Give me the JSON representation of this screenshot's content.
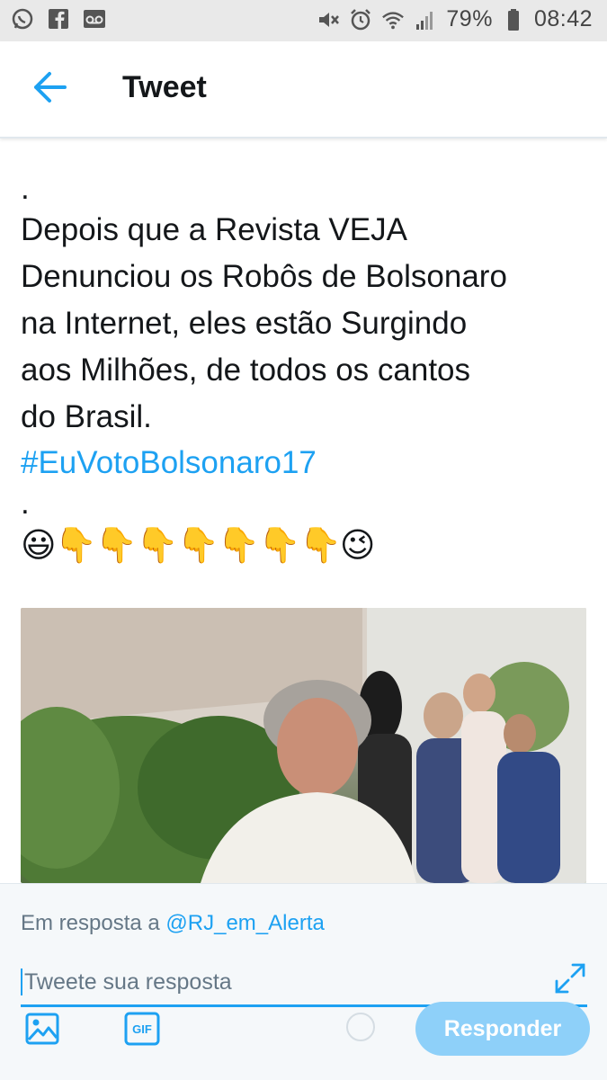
{
  "status_bar": {
    "battery": "79%",
    "time": "08:42",
    "icons_left": [
      "whatsapp-icon",
      "facebook-icon",
      "voicemail-icon"
    ],
    "icons_right": [
      "mute-icon",
      "alarm-icon",
      "wifi-icon",
      "signal-icon",
      "battery-icon"
    ]
  },
  "header": {
    "title": "Tweet",
    "back_icon": "arrow-left-icon"
  },
  "tweet": {
    "dot_top": ".",
    "lines": [
      "Depois que a Revista VEJA",
      "Denunciou os Robôs de Bolsonaro",
      "na Internet, eles estão Surgindo",
      "aos Milhões, de todos os cantos",
      "do Brasil."
    ],
    "hashtag": "#EuVotoBolsonaro17",
    "dot_bottom": ".",
    "emojis": "😃👇👇👇👇👇👇👇😉"
  },
  "media": {
    "type": "video-thumbnail"
  },
  "reply": {
    "in_reply_prefix": "Em resposta a",
    "in_reply_handle": "@RJ_em_Alerta",
    "placeholder": "Tweete sua resposta",
    "button_label": "Responder",
    "gif_label": "GIF"
  },
  "colors": {
    "accent": "#1da1f2",
    "button_disabled": "#8ed0f9",
    "text": "#14171a",
    "muted": "#657786"
  }
}
